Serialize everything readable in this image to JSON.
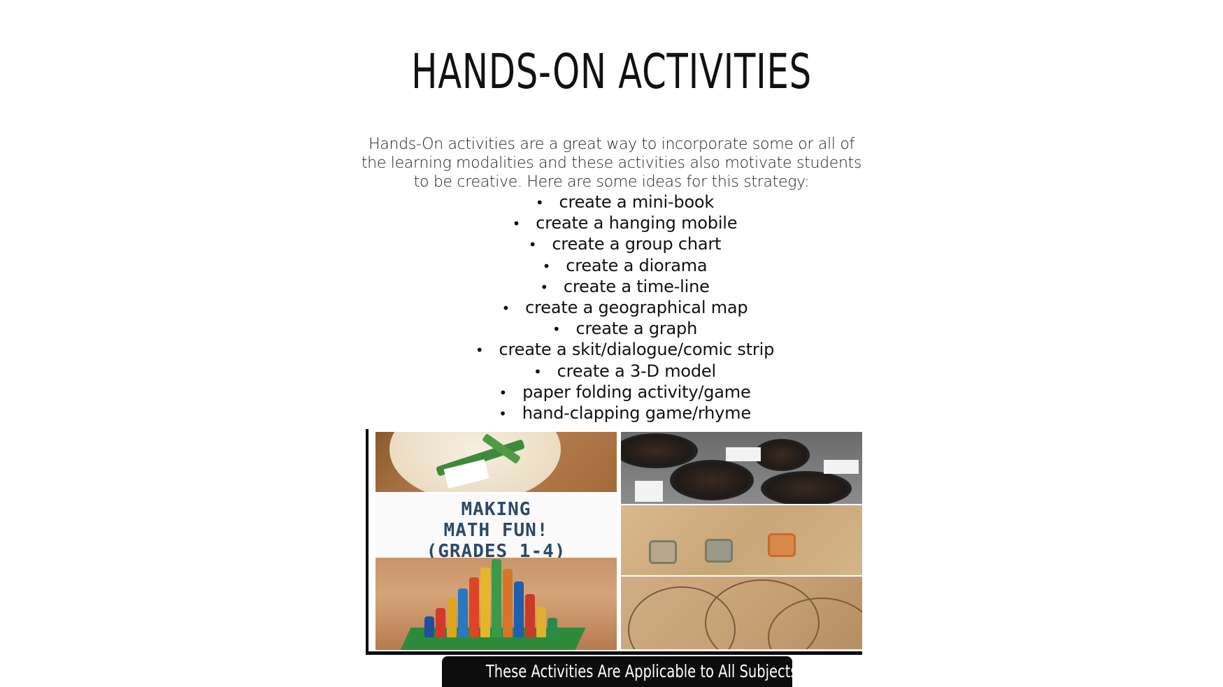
{
  "slide": {
    "title": "HANDS-ON ACTIVITIES",
    "intro": "Hands-On activities are a great way to incorporate some or all of the learning modalities and these activities also motivate students to be creative. Here are some ideas for this strategy:",
    "bullet_symbol": "•",
    "ideas": [
      "create a mini-book",
      "create a hanging mobile",
      "create a group chart",
      "create a diorama",
      "create a time-line",
      "create a geographical map",
      "create a graph",
      "create a skit/dialogue/comic strip",
      "create a 3-D model",
      "paper folding activity/game",
      "hand-clapping game/rhyme"
    ],
    "image": {
      "lines": [
        "MAKING",
        "MATH FUN!",
        "(GRADES 1-4)"
      ],
      "text_color": "#2c4a66"
    },
    "footer": "These Activities Are Applicable to All Subjects"
  }
}
